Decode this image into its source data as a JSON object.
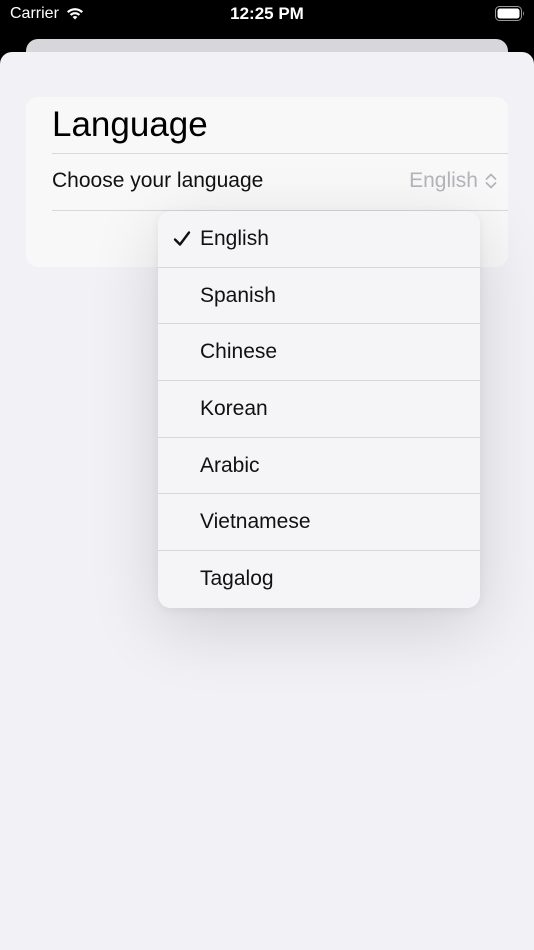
{
  "status": {
    "carrier": "Carrier",
    "time": "12:25 PM"
  },
  "card": {
    "title": "Language",
    "row_label": "Choose your language",
    "selected_value": "English"
  },
  "menu": {
    "items": [
      {
        "label": "English",
        "selected": true
      },
      {
        "label": "Spanish",
        "selected": false
      },
      {
        "label": "Chinese",
        "selected": false
      },
      {
        "label": "Korean",
        "selected": false
      },
      {
        "label": "Arabic",
        "selected": false
      },
      {
        "label": "Vietnamese",
        "selected": false
      },
      {
        "label": "Tagalog",
        "selected": false
      }
    ]
  },
  "icons": {
    "status": [
      "wifi-icon",
      "battery-icon"
    ],
    "picker": "chevron-up-down-icon",
    "selection": "checkmark-icon"
  },
  "colors": {
    "sheet_background": "#f1f1f6",
    "card_background": "#f8f8f9",
    "picker_value": "#b4b4b9",
    "status_bar": "#000000"
  }
}
